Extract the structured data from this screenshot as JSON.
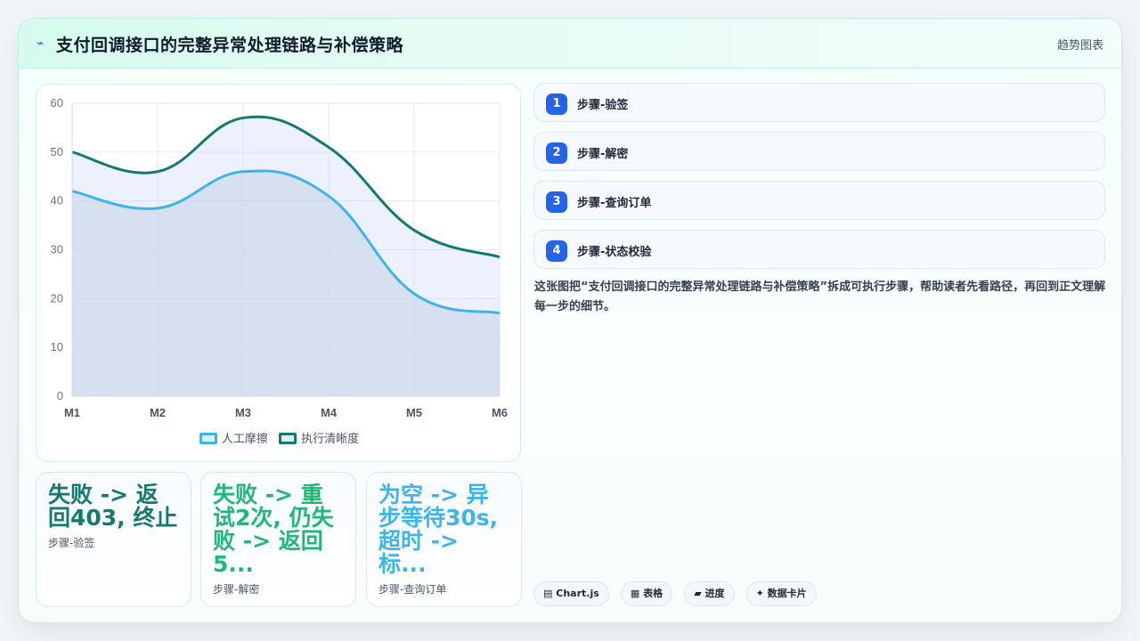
{
  "header": {
    "icon": "lightning-icon",
    "title": "支付回调接口的完整异常处理链路与补偿策略",
    "kind": "趋势图表"
  },
  "chart_data": {
    "type": "area",
    "categories": [
      "M1",
      "M2",
      "M3",
      "M4",
      "M5",
      "M6"
    ],
    "ylim": [
      0,
      60
    ],
    "yticks": [
      0,
      10,
      20,
      30,
      40,
      50,
      60
    ],
    "grid": true,
    "legend_position": "bottom",
    "series": [
      {
        "name": "人工摩擦",
        "values": [
          42,
          38.5,
          46,
          41,
          21,
          17
        ],
        "color": "#3db5ea"
      },
      {
        "name": "执行清晰度",
        "values": [
          50,
          46,
          57,
          51,
          34,
          28.5
        ],
        "color": "#137a6d"
      }
    ]
  },
  "stats": [
    {
      "value": "失败 -> 返回403, 终止",
      "label": "步骤-验签",
      "color": "#137a6d"
    },
    {
      "value": "失败 -> 重试2次, 仍失败 -> 返回5...",
      "label": "步骤-解密",
      "color": "#1fb877"
    },
    {
      "value": "为空 -> 异步等待30s, 超时 -> 标...",
      "label": "步骤-查询订单",
      "color": "#3db5ea"
    }
  ],
  "steps": [
    {
      "num": "1",
      "label": "步骤-验签"
    },
    {
      "num": "2",
      "label": "步骤-解密"
    },
    {
      "num": "3",
      "label": "步骤-查询订单"
    },
    {
      "num": "4",
      "label": "步骤-状态校验"
    }
  ],
  "description": "这张图把“支付回调接口的完整异常处理链路与补偿策略”拆成可执行步骤，帮助读者先看路径，再回到正文理解每一步的细节。",
  "tags": [
    {
      "icon": "▤",
      "label": "Chart.js"
    },
    {
      "icon": "▦",
      "label": "表格"
    },
    {
      "icon": "▰",
      "label": "进度"
    },
    {
      "icon": "✦",
      "label": "数据卡片"
    }
  ]
}
